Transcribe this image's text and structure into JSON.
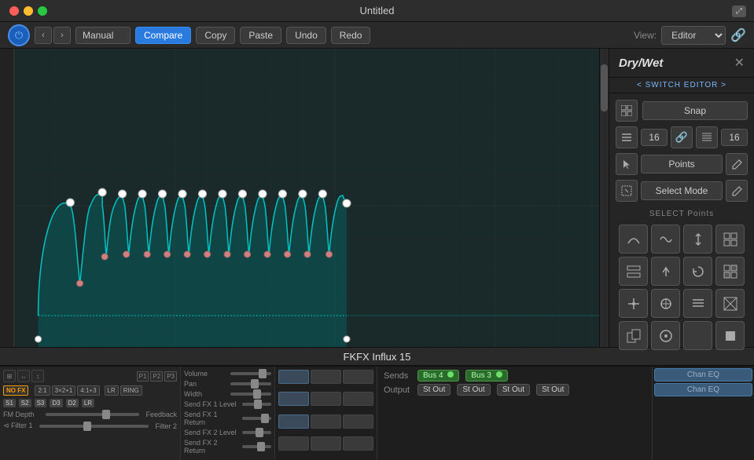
{
  "titleBar": {
    "title": "Untitled",
    "trafficLights": [
      "close",
      "minimize",
      "maximize"
    ]
  },
  "toolbar": {
    "powerLabel": "⏻",
    "navBack": "‹",
    "navForward": "›",
    "manualValue": "Manual",
    "compareLabel": "Compare",
    "copyLabel": "Copy",
    "pasteLabel": "Paste",
    "undoLabel": "Undo",
    "redoLabel": "Redo",
    "viewLabel": "View:",
    "viewValue": "Editor",
    "linkIcon": "🔗"
  },
  "rightPanel": {
    "title": "Dry/Wet",
    "closeIcon": "✕",
    "switchEditor": "< SWITCH EDITOR >",
    "snap": {
      "gridIcon": "⊞",
      "label": "Snap"
    },
    "numLeft": "16",
    "numRight": "16",
    "modes": {
      "pointsLabel": "Points",
      "selectModeLabel": "Select Mode"
    },
    "selectPoints": "SELECT Points",
    "pointButtons": [
      {
        "icon": "〜",
        "name": "curve-smooth"
      },
      {
        "icon": "∿",
        "name": "curve-wave"
      },
      {
        "icon": "↕",
        "name": "move-vertical"
      },
      {
        "icon": "⊞",
        "name": "grid-all"
      },
      {
        "icon": "⊟",
        "name": "grid-row"
      },
      {
        "icon": "⬆",
        "name": "move-up"
      },
      {
        "icon": "↻",
        "name": "rotate"
      },
      {
        "icon": "⊡",
        "name": "grid-alt"
      },
      {
        "icon": "✛",
        "name": "move-cross"
      },
      {
        "icon": "⊕",
        "name": "move-cross2"
      },
      {
        "icon": "≋",
        "name": "lines"
      },
      {
        "icon": "⊠",
        "name": "grid-x"
      },
      {
        "icon": "⧉",
        "name": "copy-box"
      },
      {
        "icon": "⊙",
        "name": "circle"
      },
      {
        "icon": "",
        "name": "empty"
      },
      {
        "icon": "◼",
        "name": "square"
      }
    ]
  },
  "bottomLabel": "FKFX Influx 15",
  "daw": {
    "sends": {
      "label": "Sends",
      "bus4": "Bus 4",
      "bus3": "Bus 3"
    },
    "output": {
      "label": "Output",
      "stOuts": [
        "St Out",
        "St Out",
        "St Out",
        "St Out"
      ]
    },
    "eq": {
      "chanEq1": "Chan EQ",
      "chanEq2": "Chan EQ"
    },
    "strips": {
      "volume": "Volume",
      "pan": "Pan",
      "width": "Width",
      "sendFx1": "Send FX 1 Level",
      "sendFx1Return": "Send FX 1 Return",
      "sendFx2": "Send FX 2 Level",
      "sendFx2Return": "Send FX 2 Return",
      "fmDepth": "FM Depth",
      "feedback": "Feedback"
    },
    "noFxLabel": "NO FX",
    "fxLabels": [
      "2:1",
      "3×2+1",
      "4:1+3"
    ]
  }
}
